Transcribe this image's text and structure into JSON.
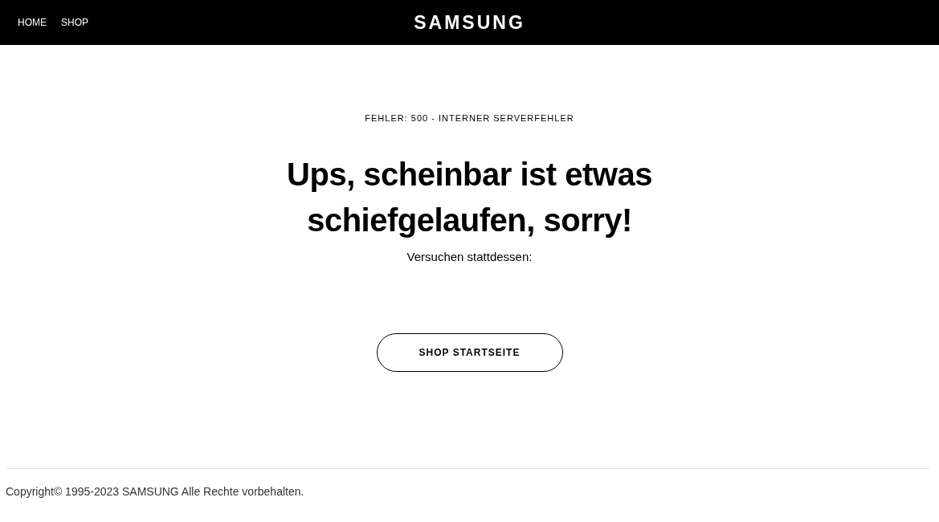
{
  "header": {
    "nav": [
      {
        "label": "HOME"
      },
      {
        "label": "SHOP"
      }
    ],
    "logo": "SAMSUNG"
  },
  "error": {
    "code": "FEHLER: 500 - INTERNER SERVERFEHLER",
    "heading_lines": [
      "Ups, scheinbar ist etwas",
      "schiefgelaufen, sorry!"
    ],
    "hint": "Versuchen stattdessen:",
    "button": "SHOP STARTSEITE"
  },
  "footer": {
    "copyright": "Copyright© 1995-2023 SAMSUNG Alle Rechte vorbehalten."
  }
}
